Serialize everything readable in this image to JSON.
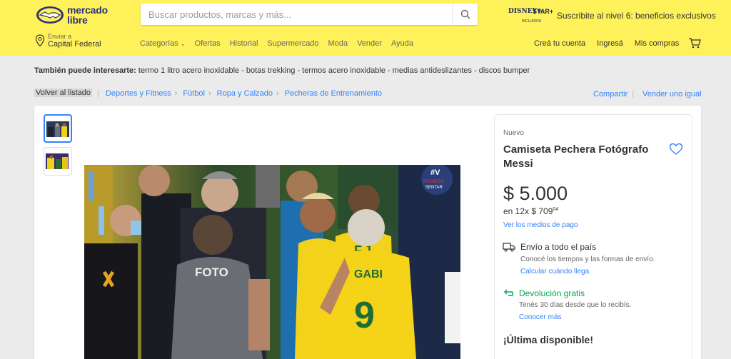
{
  "header": {
    "logo_line1": "mercado",
    "logo_line2": "libre",
    "search_placeholder": "Buscar productos, marcas y más...",
    "disney_brand": "DISNEY+",
    "disney_star": "STAR+",
    "disney_sub": "INCLUIDOS",
    "promo": "Suscribite al nivel 6: beneficios exclusivos",
    "location_label": "Enviar a",
    "location_value": "Capital Federal",
    "nav": [
      "Categorías",
      "Ofertas",
      "Historial",
      "Supermercado",
      "Moda",
      "Vender",
      "Ayuda"
    ],
    "account": [
      "Creá tu cuenta",
      "Ingresá",
      "Mis compras"
    ]
  },
  "suggestions": {
    "label": "También puede interesarte:",
    "items": "termo 1 litro acero inoxidable - botas trekking - termos acero inoxidable - medias antideslizantes - discos bumper"
  },
  "breadcrumb": {
    "back": "Volver al listado",
    "items": [
      "Deportes y Fitness",
      "Fútbol",
      "Ropa y Calzado",
      "Pecheras de Entrenamiento"
    ],
    "share": "Compartir",
    "sell_same": "Vender uno igual"
  },
  "product": {
    "condition": "Nuevo",
    "title": "Camiseta Pechera Fotógrafo Messi",
    "price": "$ 5.000",
    "installments_prefix": "en 12x $ 709",
    "installments_cents": "04",
    "payment_link": "Ver los medios de pago",
    "shipping_title": "Envío a todo el país",
    "shipping_desc": "Conocé los tiempos y las formas de envío.",
    "shipping_link": "Calcular cuándo llega",
    "return_title": "Devolución gratis",
    "return_desc": "Tenés 30 días desde que lo recibís.",
    "return_link": "Conocer más",
    "stock": "¡Última disponible!"
  },
  "image_text": {
    "foto": "FOTO",
    "gabi": "GABI",
    "nine": "9",
    "fj": "F.J",
    "badge_top": "#V",
    "badge_mid": "PROIBIDO",
    "badge_bot": "SENTAR"
  },
  "colors": {
    "header_bg": "#fff159",
    "link": "#3483fa",
    "green": "#00a650"
  }
}
